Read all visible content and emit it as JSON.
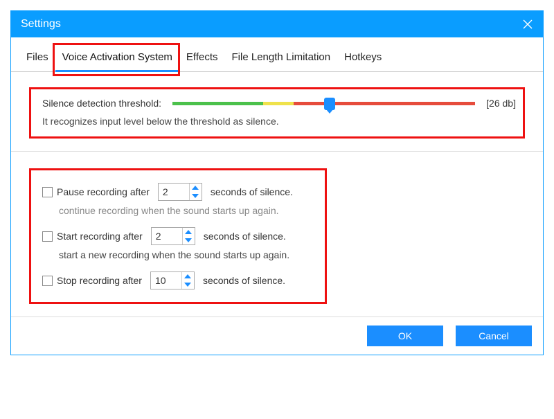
{
  "window": {
    "title": "Settings"
  },
  "tabs": {
    "items": [
      "Files",
      "Voice Activation System",
      "Effects",
      "File Length Limitation",
      "Hotkeys"
    ],
    "active_index": 1
  },
  "threshold": {
    "label": "Silence detection threshold:",
    "value_text": "[26 db]",
    "desc": "It recognizes input level below the threshold as silence.",
    "slider_percent": 52
  },
  "options": {
    "pause": {
      "label_before": "Pause recording after",
      "value": "2",
      "label_after": "seconds of silence.",
      "checked": false,
      "hint": "continue recording when the sound starts up again."
    },
    "start": {
      "label_before": "Start recording after",
      "value": "2",
      "label_after": "seconds of silence.",
      "checked": false,
      "hint": "start a new recording when the sound starts up again."
    },
    "stop": {
      "label_before": "Stop recording after",
      "value": "10",
      "label_after": "seconds of silence.",
      "checked": false
    }
  },
  "buttons": {
    "ok": "OK",
    "cancel": "Cancel"
  },
  "highlight_color": "#e11"
}
